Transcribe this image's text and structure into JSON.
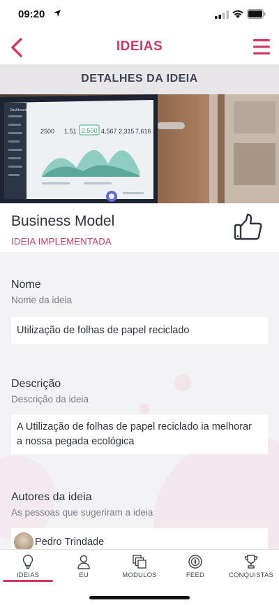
{
  "status_bar": {
    "time": "09:20",
    "icons": [
      "location-arrow-icon",
      "cellular-signal-icon",
      "wifi-icon",
      "battery-icon"
    ]
  },
  "nav": {
    "title": "IDEIAS",
    "back_icon": "chevron-left-icon",
    "menu_icon": "hamburger-menu-icon"
  },
  "section": {
    "header": "DETALHES DA IDEIA"
  },
  "hero": {
    "dashboard_title": "Dashboard",
    "metrics": [
      "2500",
      "1.51",
      "2.500",
      "4,567",
      "2,315",
      "7,616"
    ]
  },
  "idea": {
    "title": "Business Model",
    "status": "IDEIA IMPLEMENTADA",
    "like_icon": "thumbs-up-icon"
  },
  "fields": {
    "name": {
      "label": "Nome",
      "sublabel": "Nome da ideia",
      "value": "Utilização de folhas de papel reciclado"
    },
    "description": {
      "label": "Descrição",
      "sublabel": "Descrição da ideia",
      "value": "A Utilização de folhas de papel reciclado ia melhorar a nossa pegada ecológica"
    },
    "authors": {
      "label": "Autores da ideia",
      "sublabel": "As pessoas que sugeriram a ideia",
      "list": [
        {
          "name": "Pedro Trindade"
        }
      ]
    }
  },
  "tabs": [
    {
      "label": "IDEIAS",
      "icon": "lightbulb-icon",
      "active": true
    },
    {
      "label": "EU",
      "icon": "user-icon",
      "active": false
    },
    {
      "label": "MODULOS",
      "icon": "modules-icon",
      "active": false
    },
    {
      "label": "FEED",
      "icon": "feed-icon",
      "active": false
    },
    {
      "label": "CONQUISTAS",
      "icon": "trophy-icon",
      "active": false
    }
  ],
  "colors": {
    "accent": "#d03a62",
    "text": "#2f3540",
    "background": "#f3f2f4"
  }
}
